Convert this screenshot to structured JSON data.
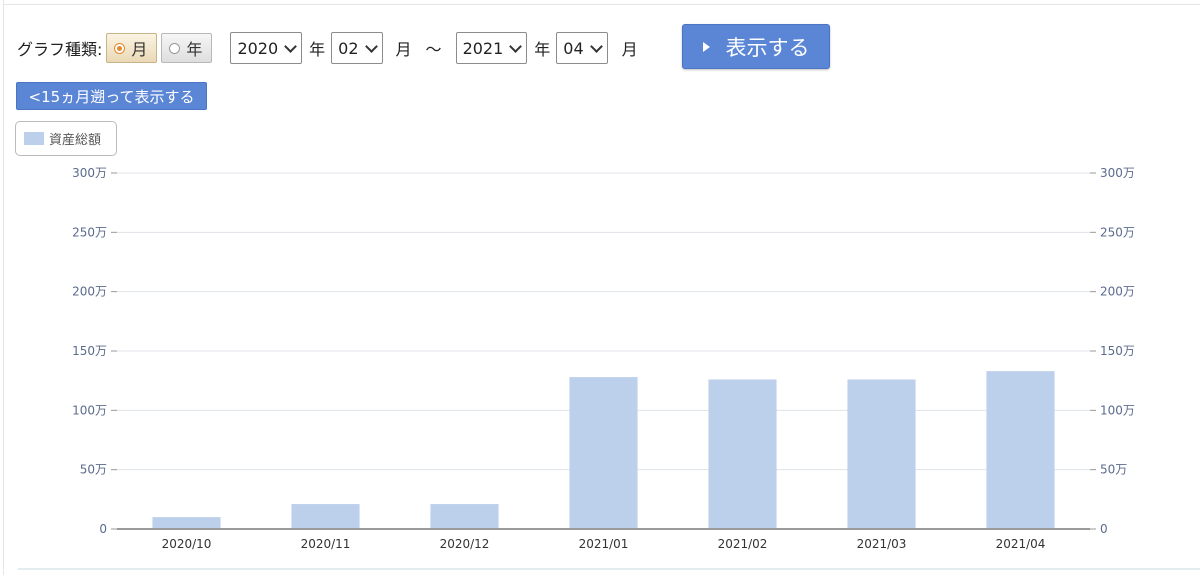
{
  "controls": {
    "graph_type_label": "グラフ種類:",
    "radio_month": "月",
    "radio_year": "年",
    "start_year": "2020",
    "start_month": "02",
    "end_year": "2021",
    "end_month": "04",
    "year_unit": "年",
    "month_unit": "月",
    "tilde": "〜",
    "show_button": "表示する",
    "back_button": "<15ヵ月遡って表示する"
  },
  "legend": {
    "label": "資産総額",
    "color": "#bccfeb"
  },
  "colors": {
    "bar": "#bccfeb",
    "accent_button": "#5b86d6",
    "grid": "#dfe3e8",
    "axis": "#9a9a9a"
  },
  "chart_data": {
    "type": "bar",
    "categories": [
      "2020/10",
      "2020/11",
      "2020/12",
      "2021/01",
      "2021/02",
      "2021/03",
      "2021/04"
    ],
    "series": [
      {
        "name": "資産総額",
        "values": [
          100000,
          210000,
          210000,
          1280000,
          1260000,
          1260000,
          1330000
        ]
      }
    ],
    "ylim": [
      0,
      3000000
    ],
    "yticks": [
      0,
      500000,
      1000000,
      1500000,
      2000000,
      2500000,
      3000000
    ],
    "ytick_labels": [
      "0",
      "50万",
      "100万",
      "150万",
      "200万",
      "250万",
      "300万"
    ],
    "dual_y_axis": true,
    "grid": true,
    "legend_position": "top-left"
  }
}
